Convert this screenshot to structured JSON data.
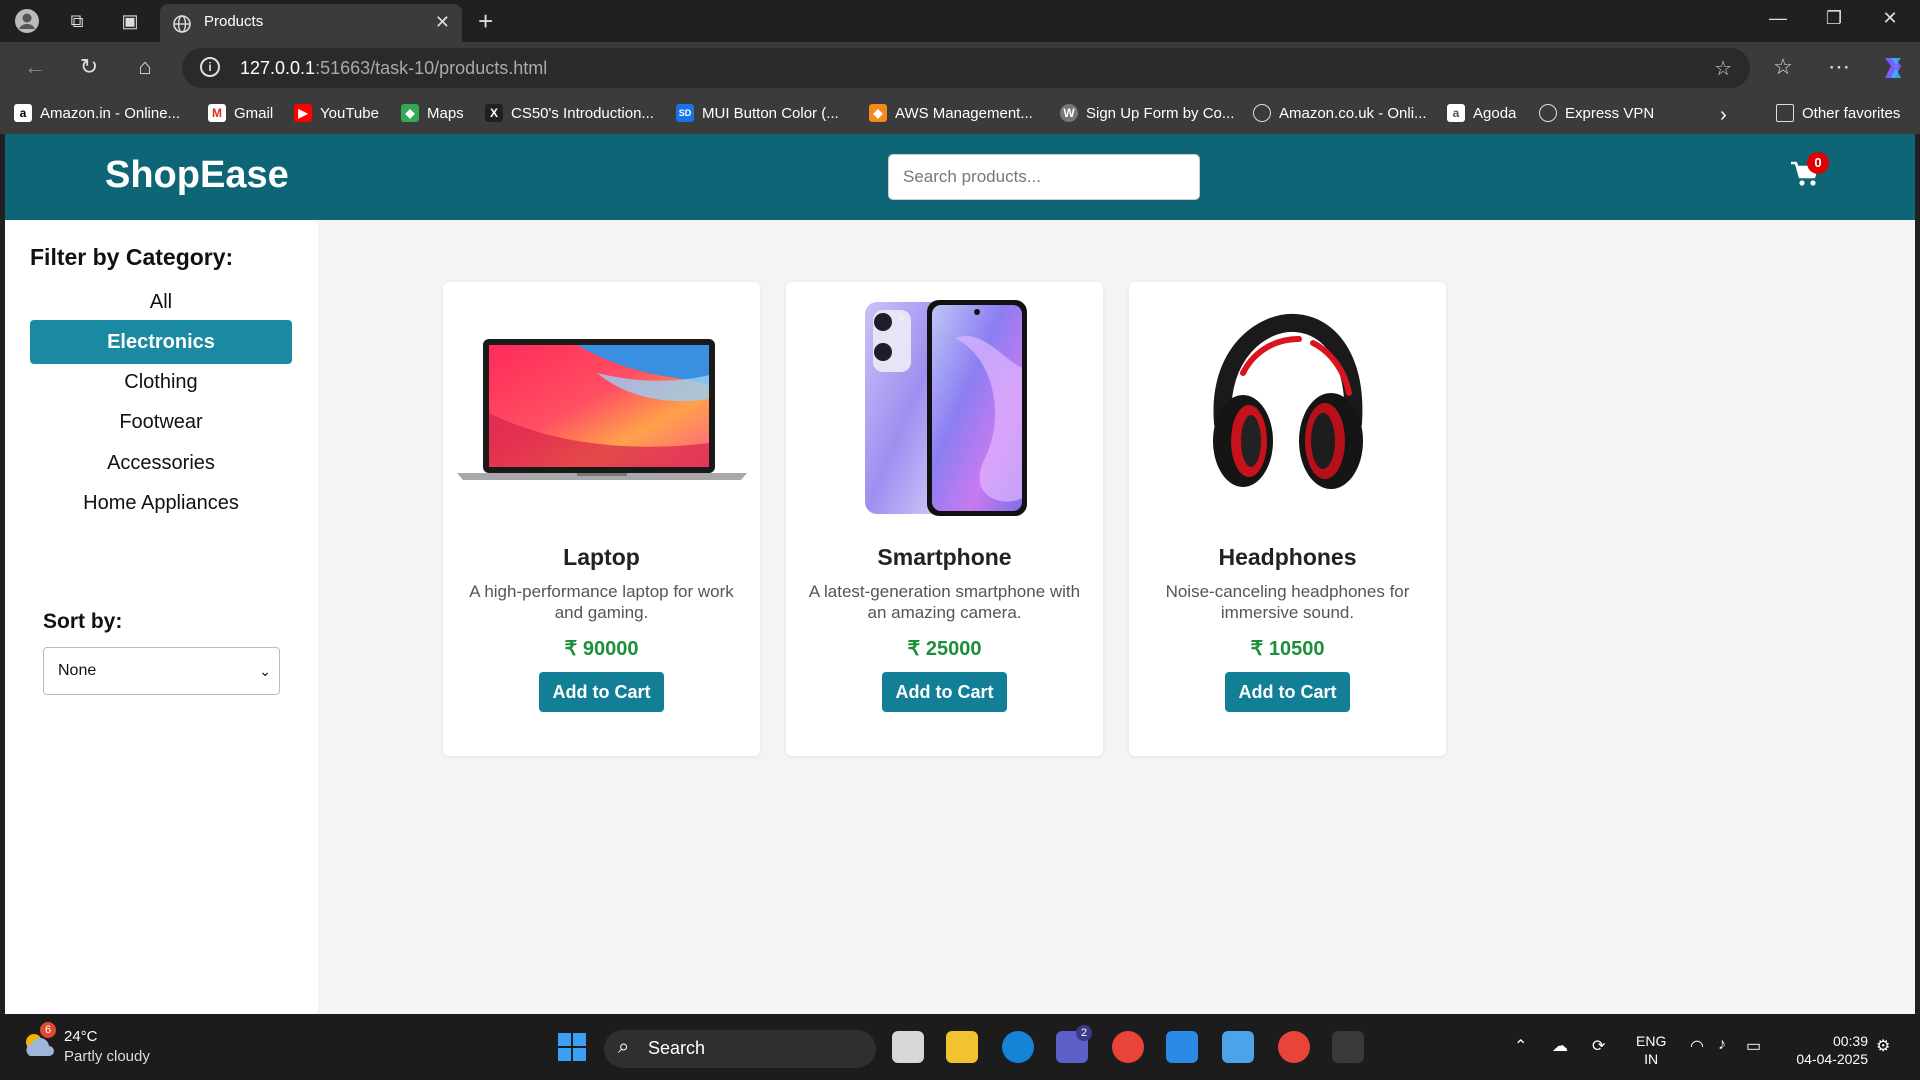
{
  "browser": {
    "tab_title": "Products",
    "url_host": "127.0.0.1",
    "url_rest": ":51663/task-10/products.html",
    "bookmarks": [
      {
        "label": "Amazon.in - Online...",
        "icon": "amazon-icon",
        "color": "#000000"
      },
      {
        "label": "Gmail",
        "icon": "gmail-icon",
        "color": "#d93025"
      },
      {
        "label": "YouTube",
        "icon": "youtube-icon",
        "color": "#ff0000"
      },
      {
        "label": "Maps",
        "icon": "maps-icon",
        "color": "#34a853"
      },
      {
        "label": "CS50's Introduction...",
        "icon": "edx-icon",
        "color": "#202020"
      },
      {
        "label": "MUI Button Color (...",
        "icon": "sd-icon",
        "color": "#1a73e8"
      },
      {
        "label": "AWS Management...",
        "icon": "aws-icon",
        "color": "#f28a1c"
      },
      {
        "label": "Sign Up Form by Co...",
        "icon": "wordpress-icon",
        "color": "#777777"
      },
      {
        "label": "Amazon.co.uk - Onli...",
        "icon": "globe-icon",
        "color": "#3b3b3b"
      },
      {
        "label": "Agoda",
        "icon": "agoda-icon",
        "color": "#555555"
      },
      {
        "label": "Express VPN",
        "icon": "globe-icon",
        "color": "#3b3b3b"
      }
    ],
    "other_favorites": "Other favorites"
  },
  "header": {
    "logo": "ShopEase",
    "search_placeholder": "Search products...",
    "cart_count": "0"
  },
  "sidebar": {
    "filter_title": "Filter by Category:",
    "categories": [
      "All",
      "Electronics",
      "Clothing",
      "Footwear",
      "Accessories",
      "Home Appliances"
    ],
    "active_category": "Electronics",
    "sort_title": "Sort by:",
    "sort_value": "None"
  },
  "products": [
    {
      "name": "Laptop",
      "desc": "A high-performance laptop for work and gaming.",
      "price": "₹ 90000",
      "button": "Add to Cart"
    },
    {
      "name": "Smartphone",
      "desc": "A latest-generation smartphone with an amazing camera.",
      "price": "₹ 25000",
      "button": "Add to Cart"
    },
    {
      "name": "Headphones",
      "desc": "Noise-canceling headphones for immersive sound.",
      "price": "₹ 10500",
      "button": "Add to Cart"
    }
  ],
  "taskbar": {
    "temp": "24°C",
    "condition": "Partly cloudy",
    "weather_badge": "6",
    "search_label": "Search",
    "teams_badge": "2",
    "lang_line1": "ENG",
    "lang_line2": "IN",
    "time": "00:39",
    "date": "04-04-2025"
  },
  "colors": {
    "header_bg": "#0e6575",
    "active_category": "#1a8aa2",
    "button": "#127f96",
    "price": "#1d8f3a",
    "cart_badge": "#e00000"
  }
}
